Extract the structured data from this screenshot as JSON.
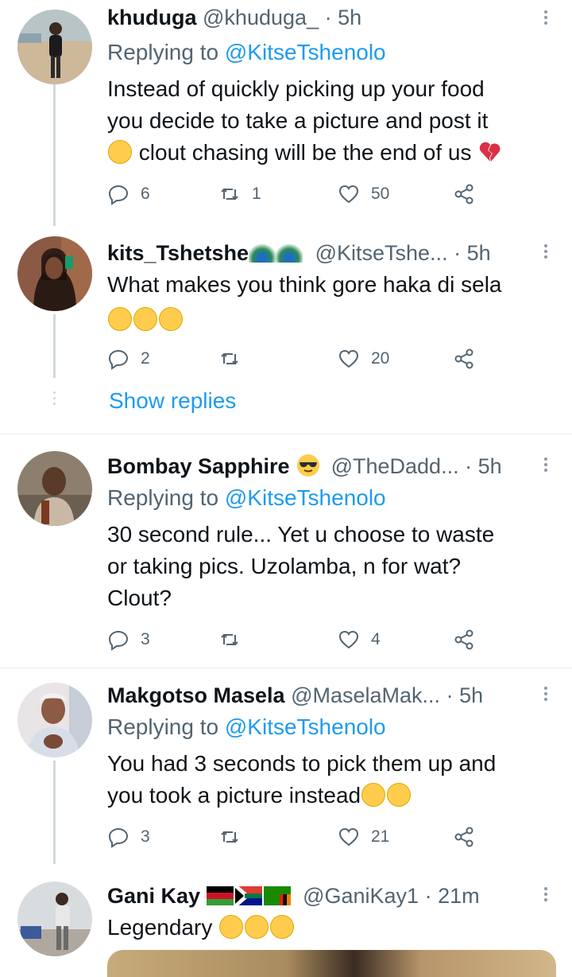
{
  "tweets": [
    {
      "name": "khuduga",
      "handle": "@khuduga_",
      "dot": "·",
      "time": "5h",
      "replying_prefix": "Replying to",
      "replying_to": "@KitseTshenolo",
      "text_line1": "Instead of quickly picking up your food",
      "text_line2": "you decide to take a picture and post it",
      "text_line3": "clout chasing will be the end of us",
      "replies": "6",
      "retweets": "1",
      "likes": "50"
    },
    {
      "name": "kits_Tshetshe",
      "handle": "@KitseTshe...",
      "dot": "·",
      "time": "5h",
      "text_line1": "What makes you think gore haka di sela",
      "replies": "2",
      "retweets": "",
      "likes": "20",
      "show_replies": "Show replies"
    },
    {
      "name": "Bombay Sapphire",
      "handle": "@TheDadd...",
      "dot": "·",
      "time": "5h",
      "replying_prefix": "Replying to",
      "replying_to": "@KitseTshenolo",
      "text_line1": "30 second rule... Yet u choose to waste",
      "text_line2": "or taking pics. Uzolamba, n for wat?",
      "text_line3": "Clout?",
      "replies": "3",
      "retweets": "",
      "likes": "4"
    },
    {
      "name": "Makgotso Masela",
      "handle": "@MaselaMak...",
      "dot": "·",
      "time": "5h",
      "replying_prefix": "Replying to",
      "replying_to": "@KitseTshenolo",
      "text_line1": "You had 3 seconds to pick them up and",
      "text_line2": "you took a picture instead",
      "replies": "3",
      "retweets": "",
      "likes": "21"
    },
    {
      "name": "Gani Kay",
      "handle": "@GaniKay1",
      "dot": "·",
      "time": "21m",
      "text_line1": "Legendary"
    }
  ],
  "icons": {
    "reply": "reply-icon",
    "retweet": "retweet-icon",
    "like": "heart-icon",
    "share": "share-icon",
    "more": "more-icon"
  },
  "colors": {
    "accent": "#1d9bf0",
    "secondary_text": "#536471",
    "thread_line": "#cfd9de"
  }
}
